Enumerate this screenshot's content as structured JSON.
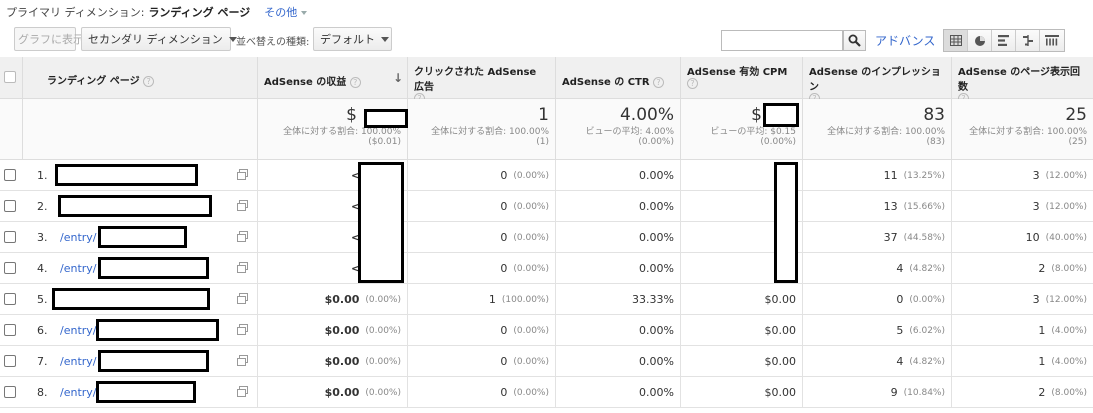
{
  "primary_dimension": {
    "label": "プライマリ ディメンション:",
    "value": "ランディング ページ",
    "other": "その他"
  },
  "toolbar": {
    "graph_button": "グラフに表示",
    "secondary_dimension": "セカンダリ ディメンション",
    "sort_label": "並べ替えの種類:",
    "sort_value": "デフォルト",
    "search_placeholder": "",
    "advanced": "アドバンス",
    "search_icon": "search-icon",
    "view_icons": [
      "table-view-icon",
      "pie-view-icon",
      "performance-view-icon",
      "comparison-view-icon",
      "pivot-view-icon"
    ]
  },
  "columns": [
    {
      "label": "ランディング ページ",
      "help": "?"
    },
    {
      "label": "AdSense の収益",
      "help": "?",
      "sorted": "desc"
    },
    {
      "label": "クリックされた AdSense 広告",
      "help": "?"
    },
    {
      "label": "AdSense の CTR",
      "help": "?"
    },
    {
      "label": "AdSense 有効 CPM",
      "help": "?"
    },
    {
      "label": "AdSense のインプレッション",
      "help": "?"
    },
    {
      "label": "AdSense のページ表示回数",
      "help": "?"
    }
  ],
  "totals": [
    {
      "big": "$",
      "sub1": "全体に対する割合: 100.00%",
      "sub2": "($0.01)"
    },
    {
      "big": "1",
      "sub1": "全体に対する割合: 100.00%",
      "sub2": "(1)"
    },
    {
      "big": "4.00%",
      "sub1": "ビューの平均: 4.00%",
      "sub2": "(0.00%)"
    },
    {
      "big": "$",
      "sub1": "ビューの平均: $0.15",
      "sub2": "(0.00%)"
    },
    {
      "big": "83",
      "sub1": "全体に対する割合: 100.00%",
      "sub2": "(83)"
    },
    {
      "big": "25",
      "sub1": "全体に対する割合: 100.00%",
      "sub2": "(25)"
    }
  ],
  "rows": [
    {
      "n": "1.",
      "link": "",
      "rev": "<$0.01",
      "rev_pct": "",
      "clicks": "0",
      "clicks_pct": "(0.00%)",
      "ctr": "0.00%",
      "cpm": "$",
      "imp": "11",
      "imp_pct": "(13.25%)",
      "pv": "3",
      "pv_pct": "(12.00%)"
    },
    {
      "n": "2.",
      "link": "",
      "rev": "<$0.01",
      "rev_pct": "",
      "clicks": "0",
      "clicks_pct": "(0.00%)",
      "ctr": "0.00%",
      "cpm": "$",
      "imp": "13",
      "imp_pct": "(15.66%)",
      "pv": "3",
      "pv_pct": "(12.00%)"
    },
    {
      "n": "3.",
      "link": "/entry/",
      "rev": "<$0.01",
      "rev_pct": "",
      "clicks": "0",
      "clicks_pct": "(0.00%)",
      "ctr": "0.00%",
      "cpm": "$",
      "imp": "37",
      "imp_pct": "(44.58%)",
      "pv": "10",
      "pv_pct": "(40.00%)"
    },
    {
      "n": "4.",
      "link": "/entry/",
      "rev": "<$0.01",
      "rev_pct": "",
      "clicks": "0",
      "clicks_pct": "(0.00%)",
      "ctr": "0.00%",
      "cpm": "<$",
      "imp": "4",
      "imp_pct": "(4.82%)",
      "pv": "2",
      "pv_pct": "(8.00%)"
    },
    {
      "n": "5.",
      "link": "",
      "rev": "$0.00",
      "rev_pct": "(0.00%)",
      "clicks": "1",
      "clicks_pct": "(100.00%)",
      "ctr": "33.33%",
      "cpm": "$0.00",
      "imp": "0",
      "imp_pct": "(0.00%)",
      "pv": "3",
      "pv_pct": "(12.00%)"
    },
    {
      "n": "6.",
      "link": "/entry/",
      "rev": "$0.00",
      "rev_pct": "(0.00%)",
      "clicks": "0",
      "clicks_pct": "(0.00%)",
      "ctr": "0.00%",
      "cpm": "$0.00",
      "imp": "5",
      "imp_pct": "(6.02%)",
      "pv": "1",
      "pv_pct": "(4.00%)"
    },
    {
      "n": "7.",
      "link": "/entry/",
      "rev": "$0.00",
      "rev_pct": "(0.00%)",
      "clicks": "0",
      "clicks_pct": "(0.00%)",
      "ctr": "0.00%",
      "cpm": "$0.00",
      "imp": "4",
      "imp_pct": "(4.82%)",
      "pv": "1",
      "pv_pct": "(4.00%)"
    },
    {
      "n": "8.",
      "link": "/entry/",
      "rev": "$0.00",
      "rev_pct": "(0.00%)",
      "clicks": "0",
      "clicks_pct": "(0.00%)",
      "ctr": "0.00%",
      "cpm": "$0.00",
      "imp": "9",
      "imp_pct": "(10.84%)",
      "pv": "2",
      "pv_pct": "(8.00%)"
    }
  ]
}
